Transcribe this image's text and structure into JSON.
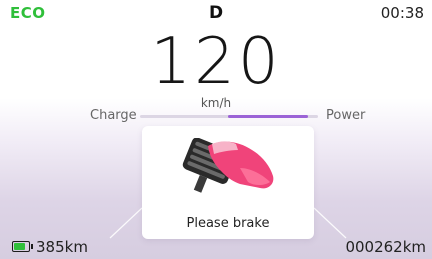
{
  "status": {
    "drive_mode": "ECO",
    "gear": "D",
    "time": "00:38"
  },
  "speed": {
    "value": "120",
    "unit": "km/h"
  },
  "power_bar": {
    "left_label": "Charge",
    "right_label": "Power",
    "level_percent": 45,
    "fill_color": "#9b63d6"
  },
  "alert": {
    "message": "Please brake",
    "icon": "brake-pedal-icon"
  },
  "footer": {
    "range": "385km",
    "odometer": "000262km",
    "battery_icon": "battery-icon",
    "battery_color": "#2fbf3a"
  },
  "colors": {
    "eco_accent": "#2fbf3a",
    "power_accent": "#9b63d6"
  }
}
